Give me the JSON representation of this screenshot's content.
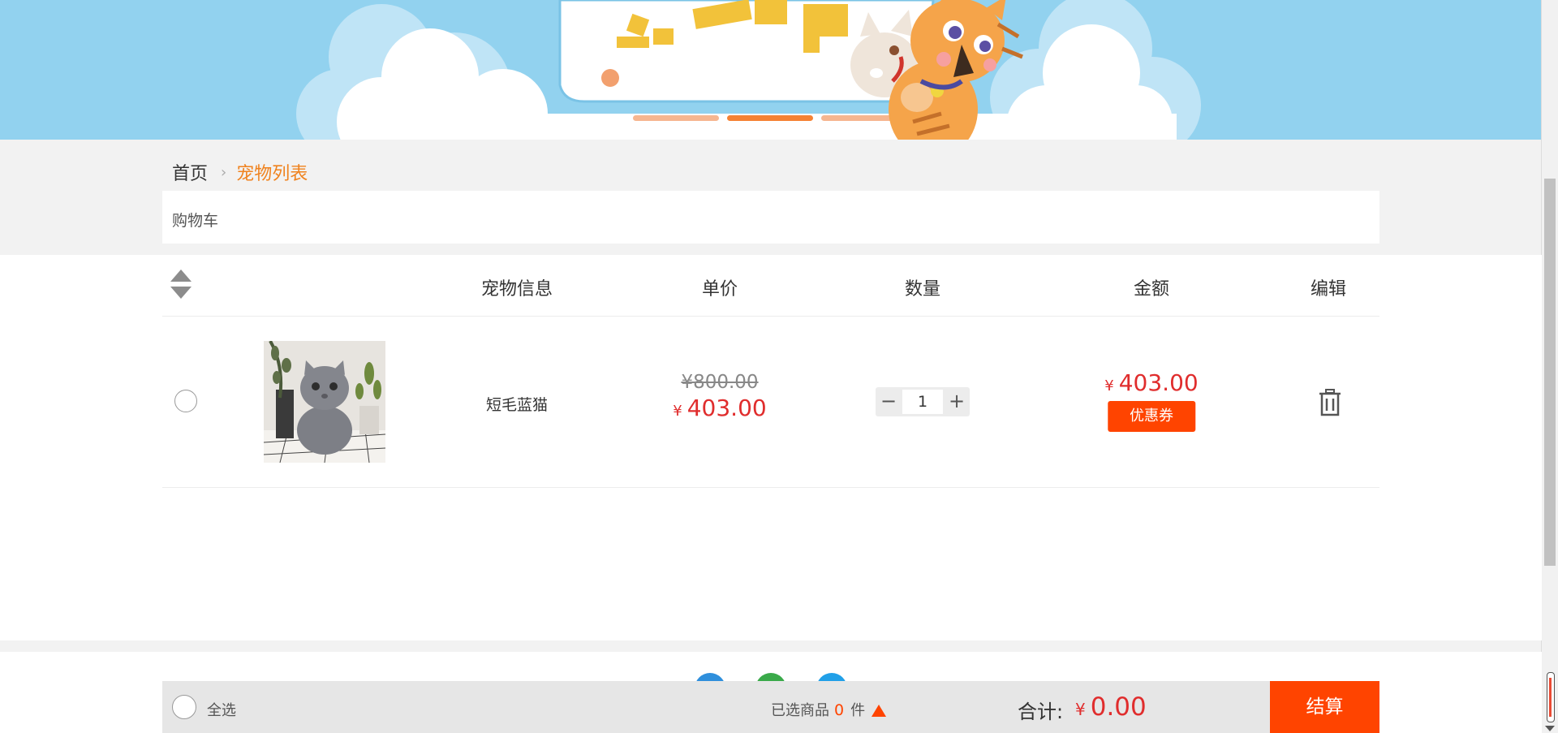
{
  "breadcrumb": {
    "home": "首页",
    "current": "宠物列表"
  },
  "cart_title": "购物车",
  "table": {
    "headers": [
      "宠物信息",
      "单价",
      "数量",
      "金额",
      "编辑"
    ]
  },
  "items": [
    {
      "name": "短毛蓝猫",
      "original_price": "¥800.00",
      "currency": "¥",
      "unit_price": "403.00",
      "quantity": "1",
      "amount": "403.00",
      "coupon_label": "优惠券",
      "image_icon": "kitten-photo"
    }
  ],
  "footer": {
    "select_all": "全选",
    "selected_prefix": "已选商品",
    "selected_count": "0",
    "selected_unit": "件",
    "total_label": "合计:",
    "currency": "¥",
    "total_value": "0.00",
    "checkout_label": "结算"
  },
  "colors": {
    "accent": "#ff4400",
    "price": "#e02d2d",
    "breadcrumb_active": "#f0831f",
    "banner_sky": "#92d2ef"
  }
}
